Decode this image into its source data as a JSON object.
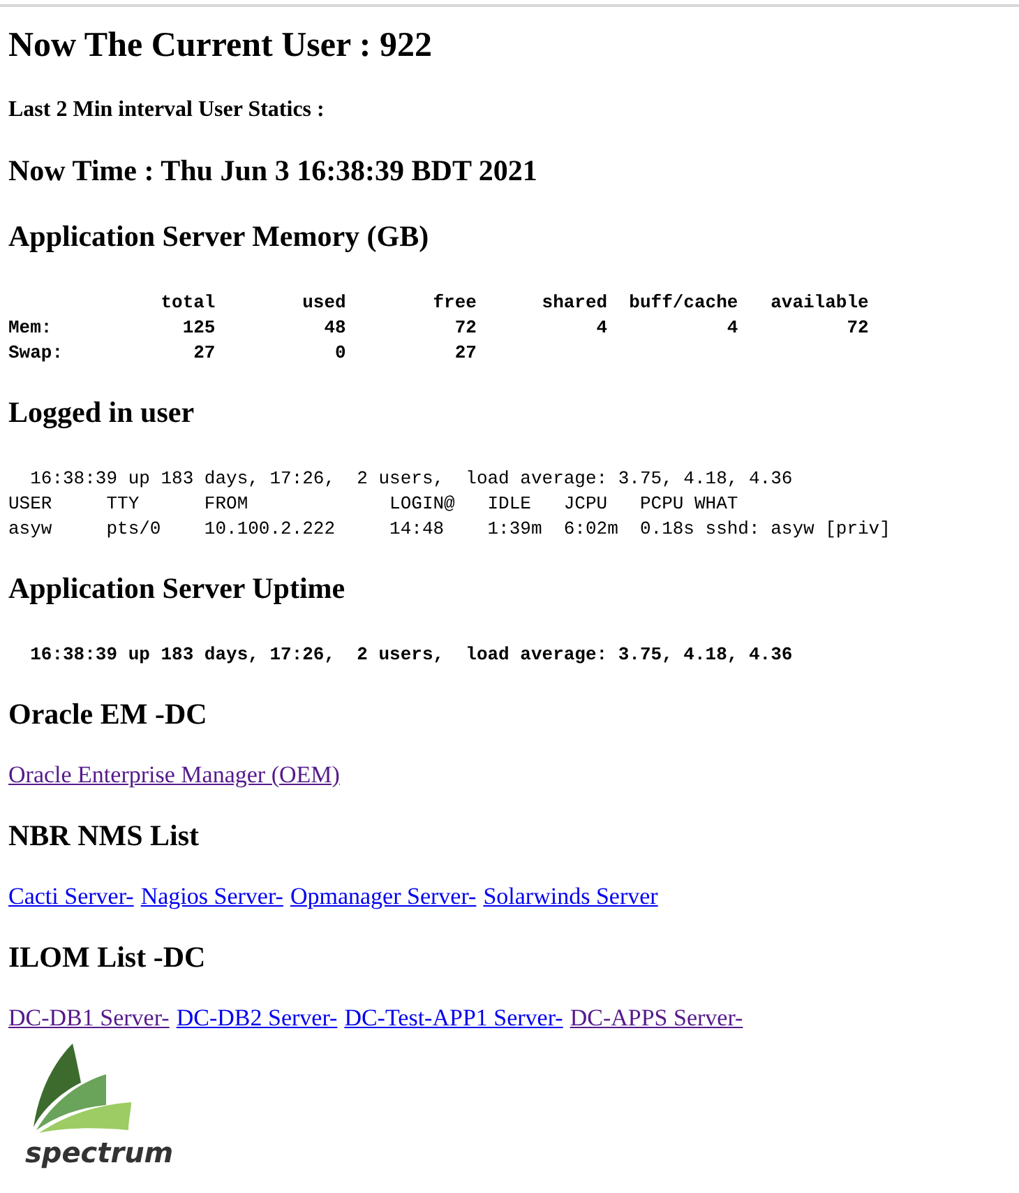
{
  "sections": [
    {
      "kind": "title",
      "text": "Now The Current User : 922"
    },
    {
      "kind": "subtitle",
      "text": "Last 2 Min interval User Statics :"
    },
    {
      "kind": "heading",
      "text": "Now Time : Thu Jun 3 16:38:39 BDT 2021"
    },
    {
      "kind": "heading",
      "text": "Application Server Memory (GB)"
    },
    {
      "kind": "output",
      "bold": true,
      "lines": [
        "              total        used        free      shared  buff/cache   available",
        "Mem:            125          48          72           4           4          72",
        "Swap:            27           0          27"
      ]
    },
    {
      "kind": "heading",
      "text": "Logged in user"
    },
    {
      "kind": "output",
      "bold": false,
      "lines": [
        "  16:38:39 up 183 days, 17:26,  2 users,  load average: 3.75, 4.18, 4.36",
        "USER     TTY      FROM             LOGIN@   IDLE   JCPU   PCPU WHAT",
        "asyw     pts/0    10.100.2.222     14:48    1:39m  6:02m  0.18s sshd: asyw [priv]"
      ]
    },
    {
      "kind": "heading",
      "text": "Application Server Uptime"
    },
    {
      "kind": "output",
      "bold": true,
      "lines": [
        "  16:38:39 up 183 days, 17:26,  2 users,  load average: 3.75, 4.18, 4.36"
      ]
    },
    {
      "kind": "heading",
      "text": "Oracle EM -DC"
    },
    {
      "kind": "links",
      "links": [
        {
          "text": "Oracle Enterprise Manager (OEM)",
          "visited": true
        }
      ]
    },
    {
      "kind": "heading",
      "text": "NBR NMS List"
    },
    {
      "kind": "links",
      "links": [
        {
          "text": "Cacti Server-",
          "visited": false
        },
        {
          "text": "Nagios Server-",
          "visited": false
        },
        {
          "text": "Opmanager Server-",
          "visited": false
        },
        {
          "text": "Solarwinds Server",
          "visited": false
        }
      ]
    },
    {
      "kind": "heading",
      "text": "ILOM List -DC"
    },
    {
      "kind": "links",
      "links": [
        {
          "text": "DC-DB1 Server-",
          "visited": true
        },
        {
          "text": "DC-DB2 Server-",
          "visited": false
        },
        {
          "text": "DC-Test-APP1 Server-",
          "visited": false
        },
        {
          "text": "DC-APPS Server-",
          "visited": true
        }
      ]
    }
  ],
  "logo": {
    "text": "spectrum"
  }
}
